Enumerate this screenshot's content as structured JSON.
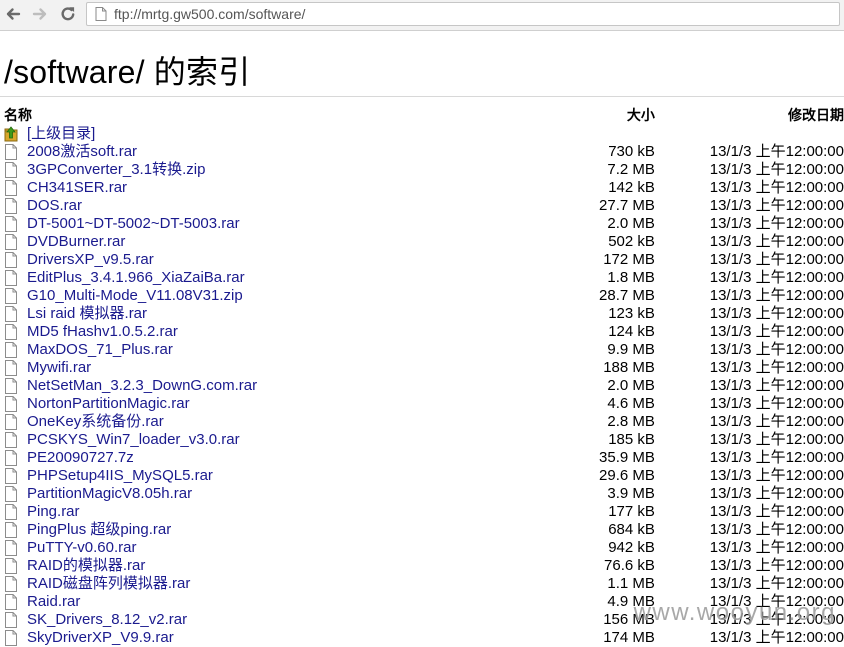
{
  "browser": {
    "url": "ftp://mrtg.gw500.com/software/"
  },
  "page": {
    "heading": "/software/ 的索引"
  },
  "table": {
    "headers": {
      "name": "名称",
      "size": "大小",
      "modified": "修改日期"
    },
    "parent": {
      "label": "[上级目录]"
    },
    "rows": [
      {
        "name": "2008激活soft.rar",
        "size": "730 kB",
        "date": "13/1/3 上午12:00:00"
      },
      {
        "name": "3GPConverter_3.1转换.zip",
        "size": "7.2 MB",
        "date": "13/1/3 上午12:00:00"
      },
      {
        "name": "CH341SER.rar",
        "size": "142 kB",
        "date": "13/1/3 上午12:00:00"
      },
      {
        "name": "DOS.rar",
        "size": "27.7 MB",
        "date": "13/1/3 上午12:00:00"
      },
      {
        "name": "DT-5001~DT-5002~DT-5003.rar",
        "size": "2.0 MB",
        "date": "13/1/3 上午12:00:00"
      },
      {
        "name": "DVDBurner.rar",
        "size": "502 kB",
        "date": "13/1/3 上午12:00:00"
      },
      {
        "name": "DriversXP_v9.5.rar",
        "size": "172 MB",
        "date": "13/1/3 上午12:00:00"
      },
      {
        "name": "EditPlus_3.4.1.966_XiaZaiBa.rar",
        "size": "1.8 MB",
        "date": "13/1/3 上午12:00:00"
      },
      {
        "name": "G10_Multi-Mode_V11.08V31.zip",
        "size": "28.7 MB",
        "date": "13/1/3 上午12:00:00"
      },
      {
        "name": "Lsi raid 模拟器.rar",
        "size": "123 kB",
        "date": "13/1/3 上午12:00:00"
      },
      {
        "name": "MD5 fHashv1.0.5.2.rar",
        "size": "124 kB",
        "date": "13/1/3 上午12:00:00"
      },
      {
        "name": "MaxDOS_71_Plus.rar",
        "size": "9.9 MB",
        "date": "13/1/3 上午12:00:00"
      },
      {
        "name": "Mywifi.rar",
        "size": "188 MB",
        "date": "13/1/3 上午12:00:00"
      },
      {
        "name": "NetSetMan_3.2.3_DownG.com.rar",
        "size": "2.0 MB",
        "date": "13/1/3 上午12:00:00"
      },
      {
        "name": "NortonPartitionMagic.rar",
        "size": "4.6 MB",
        "date": "13/1/3 上午12:00:00"
      },
      {
        "name": "OneKey系统备份.rar",
        "size": "2.8 MB",
        "date": "13/1/3 上午12:00:00"
      },
      {
        "name": "PCSKYS_Win7_loader_v3.0.rar",
        "size": "185 kB",
        "date": "13/1/3 上午12:00:00"
      },
      {
        "name": "PE20090727.7z",
        "size": "35.9 MB",
        "date": "13/1/3 上午12:00:00"
      },
      {
        "name": "PHPSetup4IIS_MySQL5.rar",
        "size": "29.6 MB",
        "date": "13/1/3 上午12:00:00"
      },
      {
        "name": "PartitionMagicV8.05h.rar",
        "size": "3.9 MB",
        "date": "13/1/3 上午12:00:00"
      },
      {
        "name": "Ping.rar",
        "size": "177 kB",
        "date": "13/1/3 上午12:00:00"
      },
      {
        "name": "PingPlus 超级ping.rar",
        "size": "684 kB",
        "date": "13/1/3 上午12:00:00"
      },
      {
        "name": "PuTTY-v0.60.rar",
        "size": "942 kB",
        "date": "13/1/3 上午12:00:00"
      },
      {
        "name": "RAID的模拟器.rar",
        "size": "76.6 kB",
        "date": "13/1/3 上午12:00:00"
      },
      {
        "name": "RAID磁盘阵列模拟器.rar",
        "size": "1.1 MB",
        "date": "13/1/3 上午12:00:00"
      },
      {
        "name": "Raid.rar",
        "size": "4.9 MB",
        "date": "13/1/3 上午12:00:00"
      },
      {
        "name": "SK_Drivers_8.12_v2.rar",
        "size": "156 MB",
        "date": "13/1/3 上午12:00:00"
      },
      {
        "name": "SkyDriverXP_V9.9.rar",
        "size": "174 MB",
        "date": "13/1/3 上午12:00:00"
      }
    ]
  },
  "watermark": "www.wooyun.org",
  "icons": {
    "back": "arrow-left-icon",
    "forward": "arrow-right-icon",
    "reload": "reload-icon",
    "page": "page-icon",
    "parent": "folder-up-icon",
    "file": "file-icon"
  },
  "colors": {
    "link": "#1a1a8e",
    "parent_arrow": "#3f9a1a"
  }
}
